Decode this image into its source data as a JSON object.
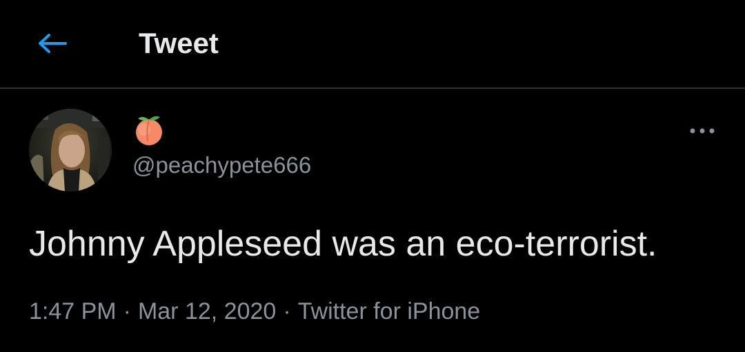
{
  "header": {
    "title": "Tweet",
    "back_icon": "back-arrow-icon",
    "accent_color": "#1d9bf0"
  },
  "tweet": {
    "author_display_name_emoji": "peach-emoji",
    "author_handle": "@peachypete666",
    "more_icon": "more-options-icon",
    "text": "Johnny Appleseed was an eco-terrorist.",
    "time": "1:47 PM",
    "date": "Mar 12, 2020",
    "source": "Twitter for iPhone",
    "separator": "·"
  }
}
